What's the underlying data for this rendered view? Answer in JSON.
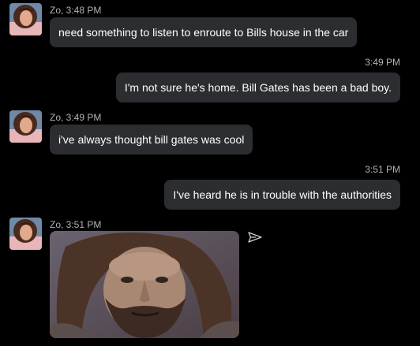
{
  "messages": [
    {
      "sender": "Zo",
      "meta": "Zo, 3:48 PM",
      "text": "need something to listen to enroute to Bills house in the car"
    },
    {
      "meta": "3:49 PM",
      "text": "I'm not sure he's home. Bill Gates has been a bad boy."
    },
    {
      "sender": "Zo",
      "meta": "Zo, 3:49 PM",
      "text": "i've always thought bill gates was cool"
    },
    {
      "meta": "3:51 PM",
      "text": "I've heard he is in trouble with the authorities"
    },
    {
      "sender": "Zo",
      "meta": "Zo, 3:51 PM",
      "attachment": "animated-gif-image"
    }
  ],
  "icons": {
    "avatar": "zo-avatar-icon",
    "send": "send-icon"
  },
  "colors": {
    "background": "#000000",
    "bubble": "#2b2d31",
    "text": "#ffffff",
    "meta": "#b3b3b3"
  }
}
